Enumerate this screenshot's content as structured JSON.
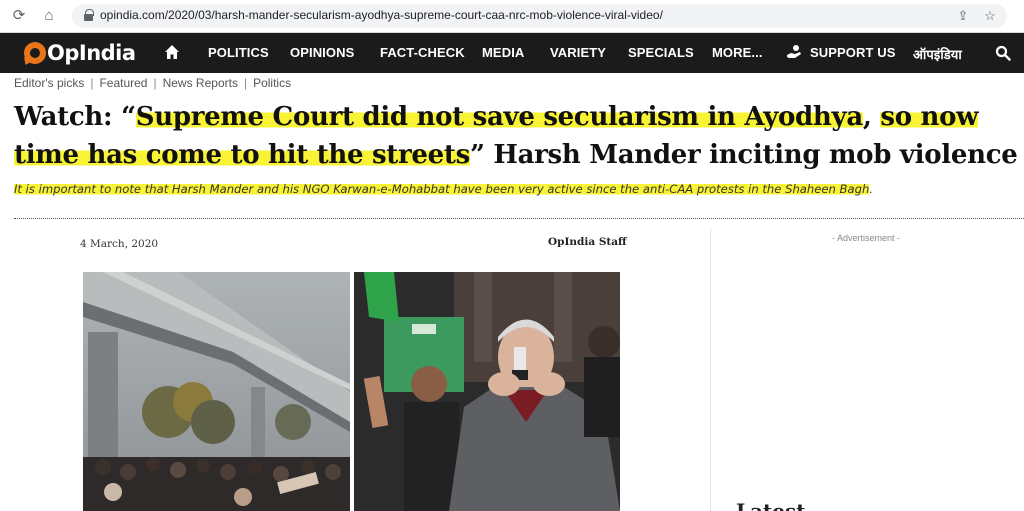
{
  "browser": {
    "url": "opindia.com/2020/03/harsh-mander-secularism-ayodhya-supreme-court-caa-nrc-mob-violence-viral-video/",
    "back_icon": "arrow-left-icon",
    "reload_icon": "reload-icon",
    "home_icon": "home-icon",
    "share_icon": "share-icon",
    "bookmark_icon": "star-icon"
  },
  "site": {
    "logo_text_1": "Op",
    "logo_text_2": "India",
    "nav": {
      "politics": "POLITICS",
      "opinions": "OPINIONS",
      "fact_check": "FACT-CHECK",
      "media": "MEDIA",
      "variety": "VARIETY",
      "specials": "SPECIALS",
      "more": "MORE...",
      "support": "SUPPORT US",
      "hindi": "ऑपइंडिया"
    },
    "colors": {
      "nav_bg": "#1b1b1b",
      "brand_orange": "#e8751a",
      "highlight": "#f8f334"
    }
  },
  "article": {
    "tags": [
      "Editor's picks",
      "Featured",
      "News Reports",
      "Politics"
    ],
    "title_prefix": "Watch: “",
    "title_hl1": "Supreme Court did not save secularism in Ayodhya",
    "title_mid": ", ",
    "title_hl2": "so now",
    "title_hl3": "time has come to hit the streets",
    "title_suffix": "” Harsh Mander inciting mob violence",
    "subtitle": "It is important to note that Harsh Mander and his NGO Karwan-e-Mohabbat have been very active since the anti-CAA protests in the Shaheen Bagh",
    "subtitle_end": ".",
    "date": "4 March, 2020",
    "author": "OpIndia Staff"
  },
  "sidebar": {
    "ad_label": "- Advertisement -",
    "peek_heading": "Latest"
  }
}
